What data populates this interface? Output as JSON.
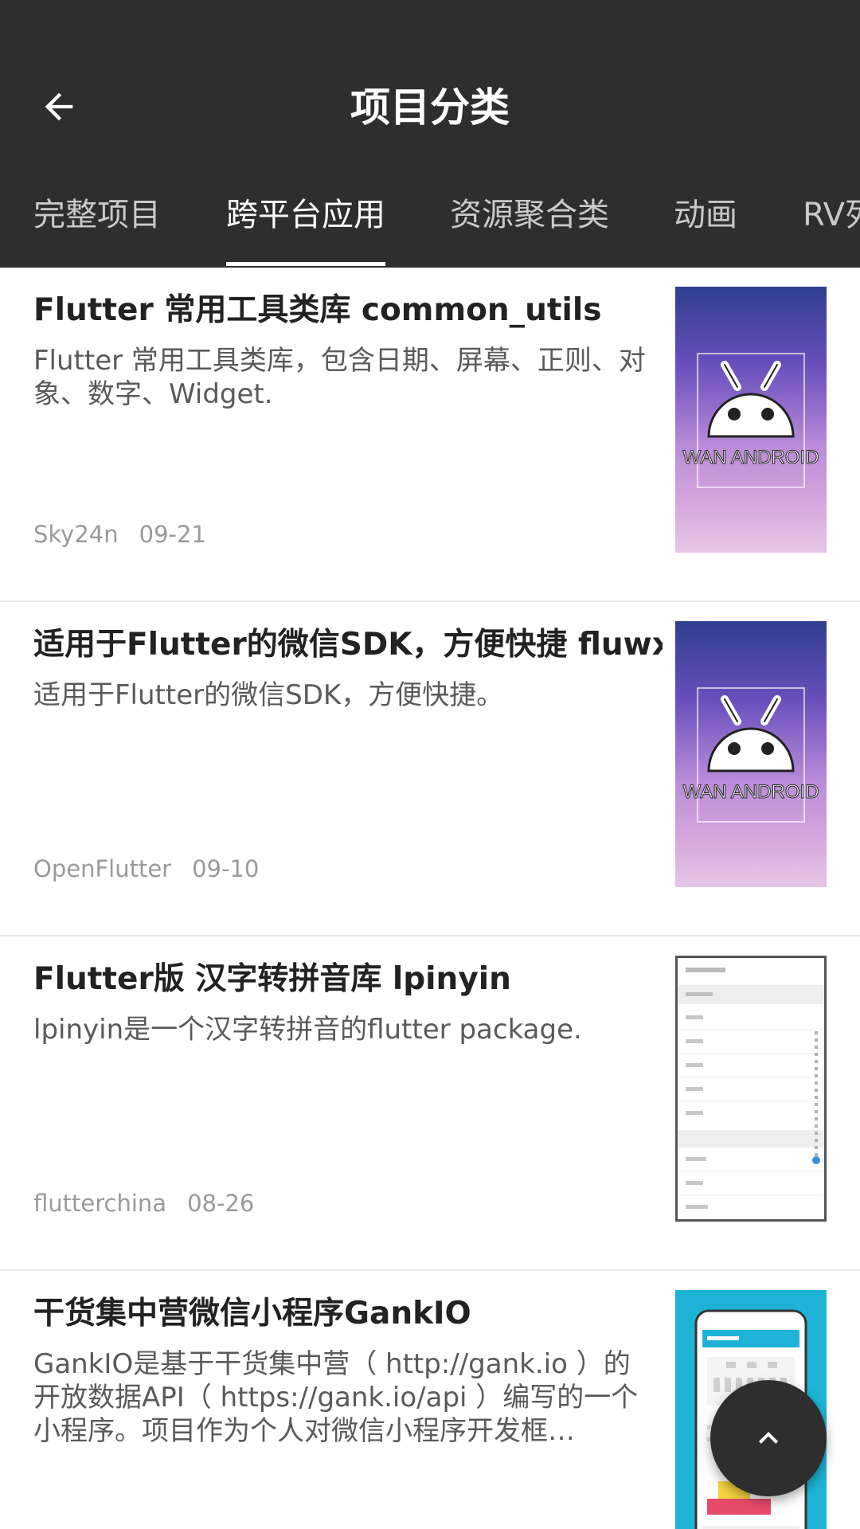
{
  "appbar": {
    "title": "项目分类",
    "back_icon": "arrow-back-icon"
  },
  "tabs": [
    {
      "label": "完整项目",
      "active": false
    },
    {
      "label": "跨平台应用",
      "active": true
    },
    {
      "label": "资源聚合类",
      "active": false
    },
    {
      "label": "动画",
      "active": false
    },
    {
      "label": "RV列",
      "active": false
    }
  ],
  "projects": [
    {
      "title": "Flutter 常用工具类库 common_utils",
      "desc": "Flutter 常用工具类库，包含日期、屏幕、正则、对象、数字、Widget.",
      "author": "Sky24n",
      "date": "09-21",
      "thumb_text": "WAN ANDROID"
    },
    {
      "title": "适用于Flutter的微信SDK，方便快捷 fluwx",
      "desc": "适用于Flutter的微信SDK，方便快捷。",
      "author": "OpenFlutter",
      "date": "09-10",
      "thumb_text": "WAN ANDROID"
    },
    {
      "title": "Flutter版  汉字转拼音库 lpinyin",
      "desc": "lpinyin是一个汉字转拼音的flutter package.",
      "author": "flutterchina",
      "date": "08-26"
    },
    {
      "title": "干货集中营微信小程序GankIO",
      "desc": "GankIO是基于干货集中营（ http://gank.io ）的开放数据API（ https://gank.io/api ）编写的一个小程序。项目作为个人对微信小程序开发框…",
      "author": "",
      "date": ""
    }
  ],
  "fab": {
    "icon": "chevron-up-icon"
  },
  "colors": {
    "toolbar": "#2e2e2e",
    "title_text": "#222222",
    "desc_text": "#5a5a5a",
    "meta_text": "#9a9a9a",
    "divider": "#e8e8e8"
  }
}
